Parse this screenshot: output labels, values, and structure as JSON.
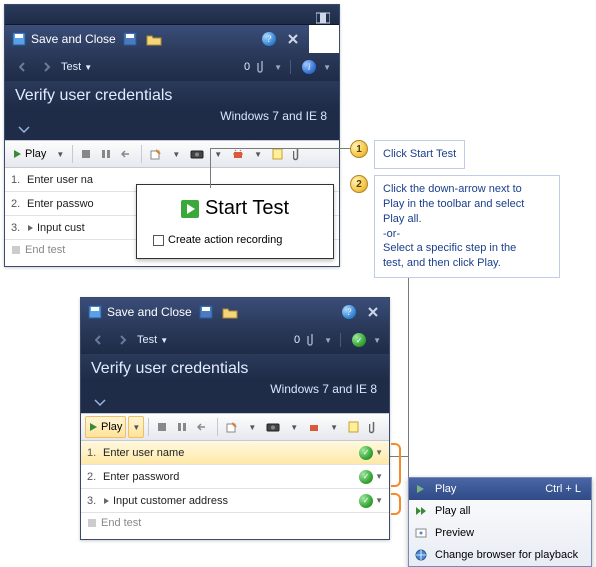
{
  "window1": {
    "save_close": "Save and Close",
    "test_label": "Test",
    "counter": "0",
    "title": "Verify user credentials",
    "environment": "Windows 7 and IE 8",
    "play_label": "Play",
    "steps": [
      {
        "num": "1.",
        "text": "Enter user na"
      },
      {
        "num": "2.",
        "text": "Enter passwo"
      },
      {
        "num": "3.",
        "text": "Input cust",
        "expand": true
      }
    ],
    "end_test": "End test"
  },
  "popup": {
    "title": "Start Test",
    "checkbox": "Create action recording"
  },
  "callout1": {
    "num": "1",
    "text": "Click Start Test"
  },
  "callout2": {
    "num": "2",
    "l1": "Click the down-arrow next to",
    "l2": "Play in the toolbar and select",
    "l3": "Play all.",
    "l4": "-or-",
    "l5": "Select a specific step in the",
    "l6": "test, and then click Play."
  },
  "window2": {
    "save_close": "Save and Close",
    "test_label": "Test",
    "counter": "0",
    "title": "Verify user credentials",
    "environment": "Windows 7 and IE 8",
    "play_label": "Play",
    "steps": [
      {
        "num": "1.",
        "text": "Enter user name"
      },
      {
        "num": "2.",
        "text": "Enter password"
      },
      {
        "num": "3.",
        "text": "Input customer address",
        "expand": true
      }
    ],
    "end_test": "End test"
  },
  "menu": {
    "play": "Play",
    "play_shortcut": "Ctrl + L",
    "play_all": "Play all",
    "preview": "Preview",
    "change_browser": "Change browser for playback"
  }
}
